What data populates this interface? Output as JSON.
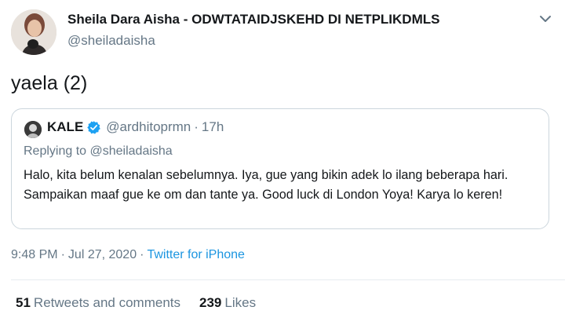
{
  "author": {
    "name": "Sheila Dara Aisha - ODWTATAIDJSKEHD DI NETPLIKDMLS",
    "handle": "@sheiladaisha"
  },
  "tweet": {
    "text": "yaela (2)"
  },
  "quoted": {
    "name": "KALE",
    "handle": "@ardhitoprmn",
    "separator": "·",
    "time": "17h",
    "replying_prefix": "Replying to",
    "replying_to": "@sheiladaisha",
    "body": "Halo, kita belum kenalan sebelumnya. Iya, gue yang bikin adek lo ilang beberapa hari. Sampaikan maaf gue ke om dan tante ya. Good luck di London Yoya! Karya lo keren!",
    "verified_color": "#1da1f2"
  },
  "meta": {
    "time": "9:48 PM",
    "separator": "·",
    "date": "Jul 27, 2020",
    "source": "Twitter for iPhone"
  },
  "stats": {
    "retweets_count": "51",
    "retweets_label": "Retweets and comments",
    "likes_count": "239",
    "likes_label": "Likes"
  },
  "colors": {
    "text": "#14171a",
    "secondary": "#657786",
    "link": "#1b95e0",
    "border": "#ccd6dd"
  },
  "icons": {
    "caret": "chevron-down-icon",
    "verified": "verified-badge-icon"
  }
}
